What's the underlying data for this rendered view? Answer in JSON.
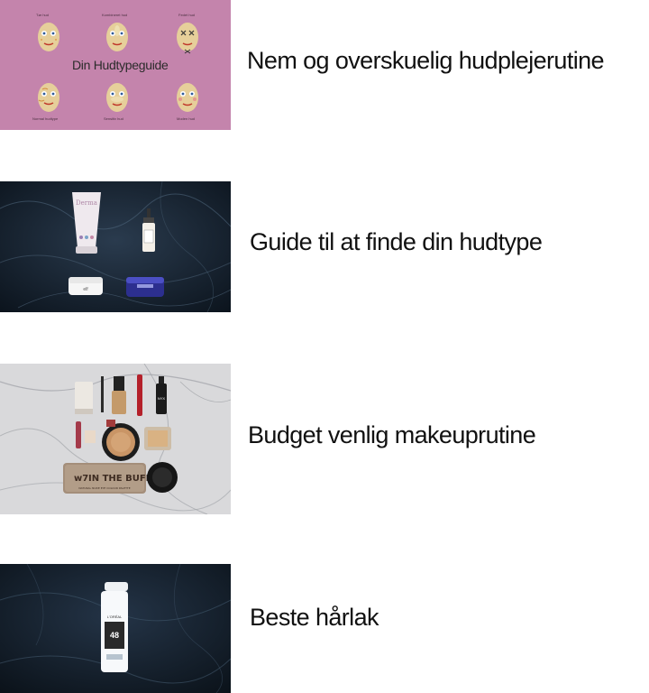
{
  "articles": [
    {
      "title": "Nem og overskuelig hudplejerutine",
      "thumbnail": {
        "heading": "Din Hudtypeguide",
        "face_labels": [
          "Tør hud",
          "Kombineret hud",
          "Fedet hud",
          "Normal hudtype",
          "Sensitiv hud",
          "Moden hud"
        ],
        "bg_color": "#c484ac"
      }
    },
    {
      "title": "Guide til at finde din hudtype",
      "thumbnail": {
        "product_text": [
          "Derma",
          "elf"
        ],
        "bg_color": "#14202c"
      }
    },
    {
      "title": "Budget venlig makeuprutine",
      "thumbnail": {
        "product_text": [
          "IN THE BUFF",
          "NATURAL NUDE EYE COLOUR PALETTE",
          "w7",
          "NYX"
        ],
        "bg_color": "#d8d8d8"
      }
    },
    {
      "title": "Beste hårlak",
      "thumbnail": {
        "product_text": [
          "L'ORÉAL",
          "48"
        ],
        "bg_color": "#101b28"
      }
    }
  ]
}
